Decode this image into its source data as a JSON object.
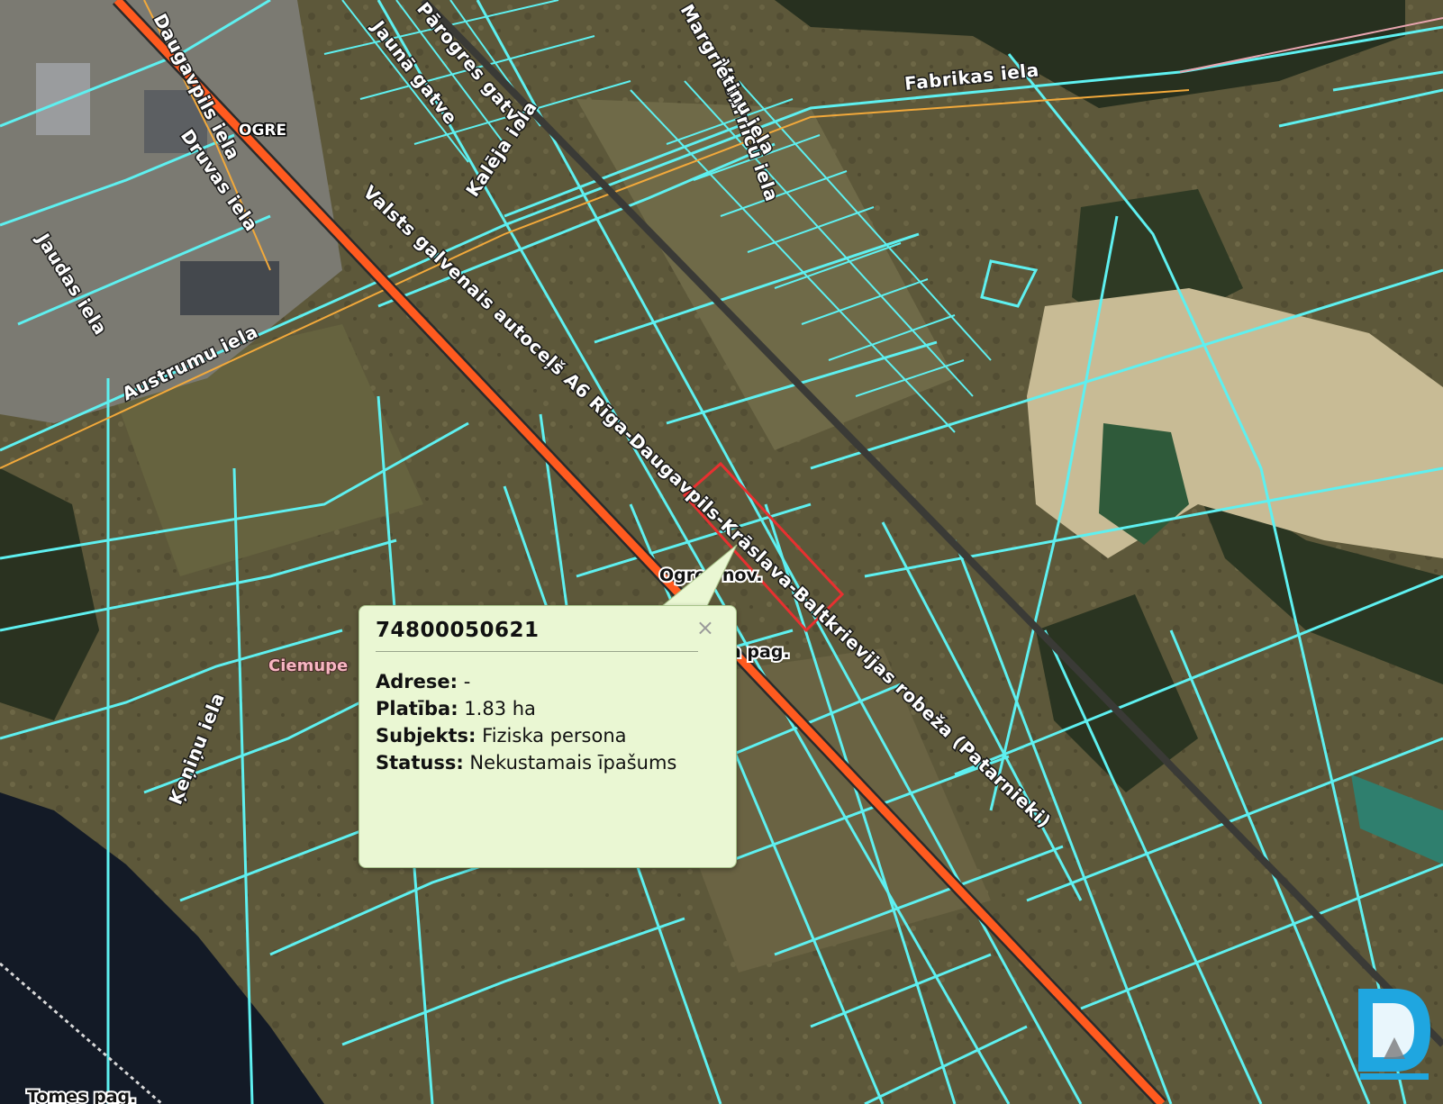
{
  "map": {
    "road_labels": [
      "Daugavpils iela",
      "Druvas iela",
      "Valsts galvenais autoceļš A6 Rīga-Daugavpils-Krāslava-Baltkrievijas robeža (Patarnieki)",
      "Austrumu iela",
      "Jaudas iela",
      "Kalēja iela",
      "Vasarnīcu iela",
      "Jaunā gatve",
      "Pārogres gatve",
      "Margrietiņu iela",
      "Fabrikas iela",
      "Ķeņiņu iela"
    ],
    "place_labels": {
      "city": "OGRE",
      "municipality": "Ogres nov.",
      "parish": "a pag.",
      "village": "Ciemupe",
      "bottom_parish": "Tomes pag."
    },
    "colors": {
      "parcel_border": "#5ef0f0",
      "highway": "#ff5a1f",
      "selected_parcel": "#e83030",
      "popup_bg": "#eaf7d3"
    }
  },
  "popup": {
    "title": "74800050621",
    "close_icon": "close-icon",
    "rows": [
      {
        "key": "Adrese:",
        "value": "-"
      },
      {
        "key": "Platība:",
        "value": "1.83 ha"
      },
      {
        "key": "Subjekts:",
        "value": "Fiziska persona"
      },
      {
        "key": "Statuss:",
        "value": "Nekustamais īpašums"
      }
    ]
  },
  "logo": {
    "icon": "d-logo-icon"
  }
}
